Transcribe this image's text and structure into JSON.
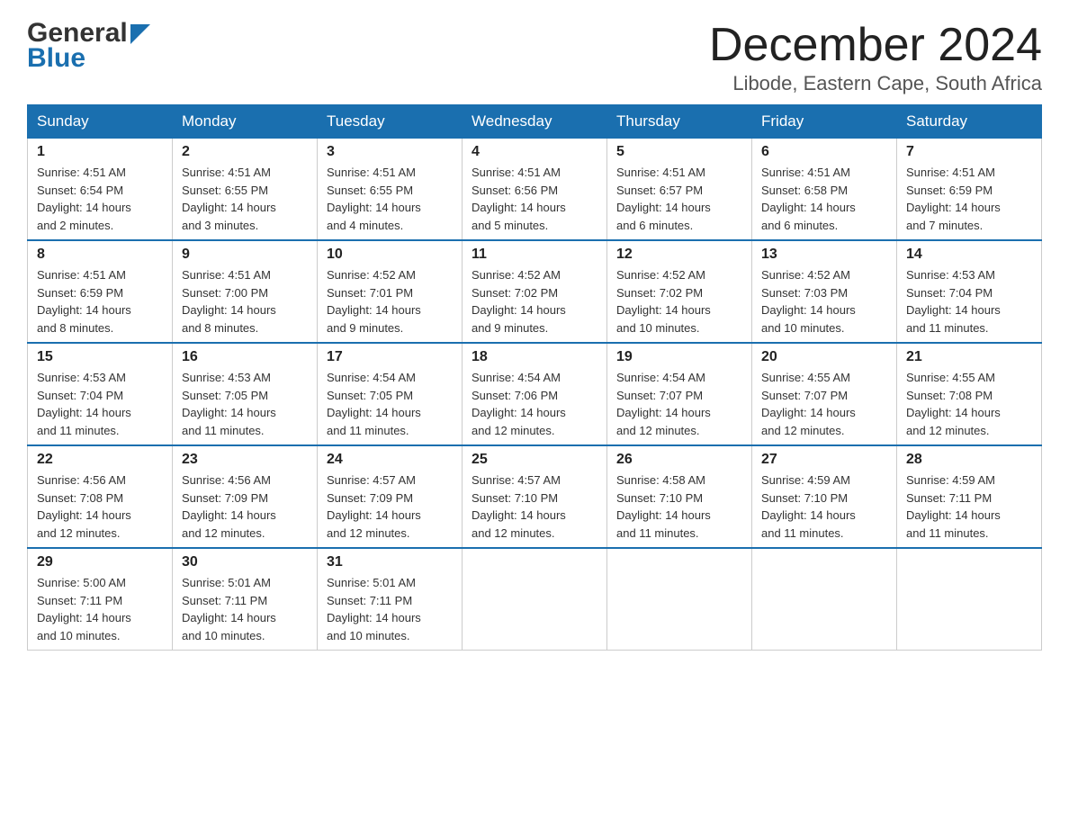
{
  "header": {
    "logo_line1": "General",
    "logo_line2": "Blue",
    "month_title": "December 2024",
    "location": "Libode, Eastern Cape, South Africa"
  },
  "weekdays": [
    "Sunday",
    "Monday",
    "Tuesday",
    "Wednesday",
    "Thursday",
    "Friday",
    "Saturday"
  ],
  "weeks": [
    [
      {
        "day": "1",
        "sunrise": "4:51 AM",
        "sunset": "6:54 PM",
        "daylight": "14 hours and 2 minutes."
      },
      {
        "day": "2",
        "sunrise": "4:51 AM",
        "sunset": "6:55 PM",
        "daylight": "14 hours and 3 minutes."
      },
      {
        "day": "3",
        "sunrise": "4:51 AM",
        "sunset": "6:55 PM",
        "daylight": "14 hours and 4 minutes."
      },
      {
        "day": "4",
        "sunrise": "4:51 AM",
        "sunset": "6:56 PM",
        "daylight": "14 hours and 5 minutes."
      },
      {
        "day": "5",
        "sunrise": "4:51 AM",
        "sunset": "6:57 PM",
        "daylight": "14 hours and 6 minutes."
      },
      {
        "day": "6",
        "sunrise": "4:51 AM",
        "sunset": "6:58 PM",
        "daylight": "14 hours and 6 minutes."
      },
      {
        "day": "7",
        "sunrise": "4:51 AM",
        "sunset": "6:59 PM",
        "daylight": "14 hours and 7 minutes."
      }
    ],
    [
      {
        "day": "8",
        "sunrise": "4:51 AM",
        "sunset": "6:59 PM",
        "daylight": "14 hours and 8 minutes."
      },
      {
        "day": "9",
        "sunrise": "4:51 AM",
        "sunset": "7:00 PM",
        "daylight": "14 hours and 8 minutes."
      },
      {
        "day": "10",
        "sunrise": "4:52 AM",
        "sunset": "7:01 PM",
        "daylight": "14 hours and 9 minutes."
      },
      {
        "day": "11",
        "sunrise": "4:52 AM",
        "sunset": "7:02 PM",
        "daylight": "14 hours and 9 minutes."
      },
      {
        "day": "12",
        "sunrise": "4:52 AM",
        "sunset": "7:02 PM",
        "daylight": "14 hours and 10 minutes."
      },
      {
        "day": "13",
        "sunrise": "4:52 AM",
        "sunset": "7:03 PM",
        "daylight": "14 hours and 10 minutes."
      },
      {
        "day": "14",
        "sunrise": "4:53 AM",
        "sunset": "7:04 PM",
        "daylight": "14 hours and 11 minutes."
      }
    ],
    [
      {
        "day": "15",
        "sunrise": "4:53 AM",
        "sunset": "7:04 PM",
        "daylight": "14 hours and 11 minutes."
      },
      {
        "day": "16",
        "sunrise": "4:53 AM",
        "sunset": "7:05 PM",
        "daylight": "14 hours and 11 minutes."
      },
      {
        "day": "17",
        "sunrise": "4:54 AM",
        "sunset": "7:05 PM",
        "daylight": "14 hours and 11 minutes."
      },
      {
        "day": "18",
        "sunrise": "4:54 AM",
        "sunset": "7:06 PM",
        "daylight": "14 hours and 12 minutes."
      },
      {
        "day": "19",
        "sunrise": "4:54 AM",
        "sunset": "7:07 PM",
        "daylight": "14 hours and 12 minutes."
      },
      {
        "day": "20",
        "sunrise": "4:55 AM",
        "sunset": "7:07 PM",
        "daylight": "14 hours and 12 minutes."
      },
      {
        "day": "21",
        "sunrise": "4:55 AM",
        "sunset": "7:08 PM",
        "daylight": "14 hours and 12 minutes."
      }
    ],
    [
      {
        "day": "22",
        "sunrise": "4:56 AM",
        "sunset": "7:08 PM",
        "daylight": "14 hours and 12 minutes."
      },
      {
        "day": "23",
        "sunrise": "4:56 AM",
        "sunset": "7:09 PM",
        "daylight": "14 hours and 12 minutes."
      },
      {
        "day": "24",
        "sunrise": "4:57 AM",
        "sunset": "7:09 PM",
        "daylight": "14 hours and 12 minutes."
      },
      {
        "day": "25",
        "sunrise": "4:57 AM",
        "sunset": "7:10 PM",
        "daylight": "14 hours and 12 minutes."
      },
      {
        "day": "26",
        "sunrise": "4:58 AM",
        "sunset": "7:10 PM",
        "daylight": "14 hours and 11 minutes."
      },
      {
        "day": "27",
        "sunrise": "4:59 AM",
        "sunset": "7:10 PM",
        "daylight": "14 hours and 11 minutes."
      },
      {
        "day": "28",
        "sunrise": "4:59 AM",
        "sunset": "7:11 PM",
        "daylight": "14 hours and 11 minutes."
      }
    ],
    [
      {
        "day": "29",
        "sunrise": "5:00 AM",
        "sunset": "7:11 PM",
        "daylight": "14 hours and 10 minutes."
      },
      {
        "day": "30",
        "sunrise": "5:01 AM",
        "sunset": "7:11 PM",
        "daylight": "14 hours and 10 minutes."
      },
      {
        "day": "31",
        "sunrise": "5:01 AM",
        "sunset": "7:11 PM",
        "daylight": "14 hours and 10 minutes."
      },
      null,
      null,
      null,
      null
    ]
  ],
  "labels": {
    "sunrise": "Sunrise:",
    "sunset": "Sunset:",
    "daylight": "Daylight:"
  }
}
